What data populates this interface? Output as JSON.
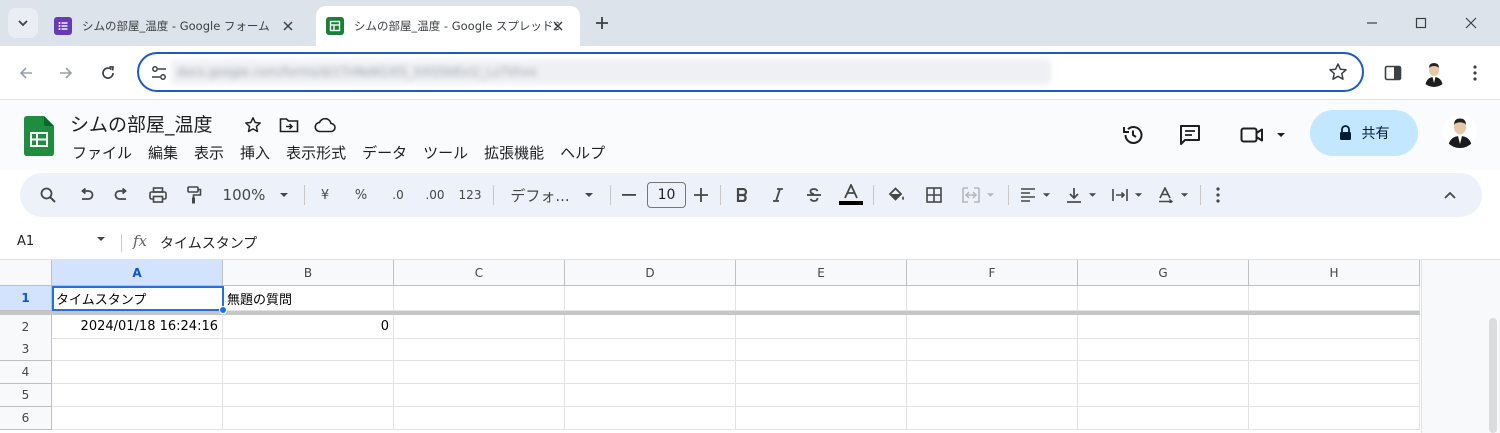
{
  "browser": {
    "tabs": [
      {
        "title": "シムの部屋_温度 - Google フォーム",
        "active": false,
        "favicon": "google-forms-icon",
        "color": "#673ab7"
      },
      {
        "title": "シムの部屋_温度 - Google スプレッドシート",
        "active": true,
        "favicon": "google-sheets-icon",
        "color": "#188038"
      }
    ],
    "address_bar": {
      "url": "docs.google.com/forms/d/1TnNeN1Xl5_XXG5bEo1l_Lz7Vhxx"
    }
  },
  "sheets": {
    "document_title": "シムの部屋_温度",
    "menu": [
      "ファイル",
      "編集",
      "表示",
      "挿入",
      "表示形式",
      "データ",
      "ツール",
      "拡張機能",
      "ヘルプ"
    ],
    "share_label": "共有",
    "toolbar": {
      "zoom": "100%",
      "currency": "¥",
      "percent": "%",
      "decrease_decimal": ".0",
      "increase_decimal": ".00",
      "number_format": "123",
      "font": "デフォ...",
      "font_size": "10"
    },
    "formula_bar": {
      "name_box": "A1",
      "fx": "fx",
      "content": "タイムスタンプ"
    },
    "grid": {
      "columns": [
        "A",
        "B",
        "C",
        "D",
        "E",
        "F",
        "G",
        "H"
      ],
      "selected_column": "A",
      "rows": [
        {
          "num": "1",
          "cells": [
            "タイムスタンプ",
            "無題の質問",
            "",
            "",
            "",
            "",
            "",
            ""
          ]
        },
        {
          "num": "2",
          "cells": [
            "2024/01/18 16:24:16",
            "0",
            "",
            "",
            "",
            "",
            "",
            ""
          ]
        },
        {
          "num": "3",
          "cells": [
            "",
            "",
            "",
            "",
            "",
            "",
            "",
            ""
          ]
        },
        {
          "num": "4",
          "cells": [
            "",
            "",
            "",
            "",
            "",
            "",
            "",
            ""
          ]
        },
        {
          "num": "5",
          "cells": [
            "",
            "",
            "",
            "",
            "",
            "",
            "",
            ""
          ]
        },
        {
          "num": "6",
          "cells": [
            "",
            "",
            "",
            "",
            "",
            "",
            "",
            ""
          ]
        }
      ],
      "selected_cell": "A1"
    }
  },
  "colors": {
    "accent": "#1a73e8",
    "sheets_green": "#188038",
    "forms_purple": "#673ab7",
    "share_bg": "#c2e7ff",
    "toolbar_bg": "#edf2fa"
  }
}
